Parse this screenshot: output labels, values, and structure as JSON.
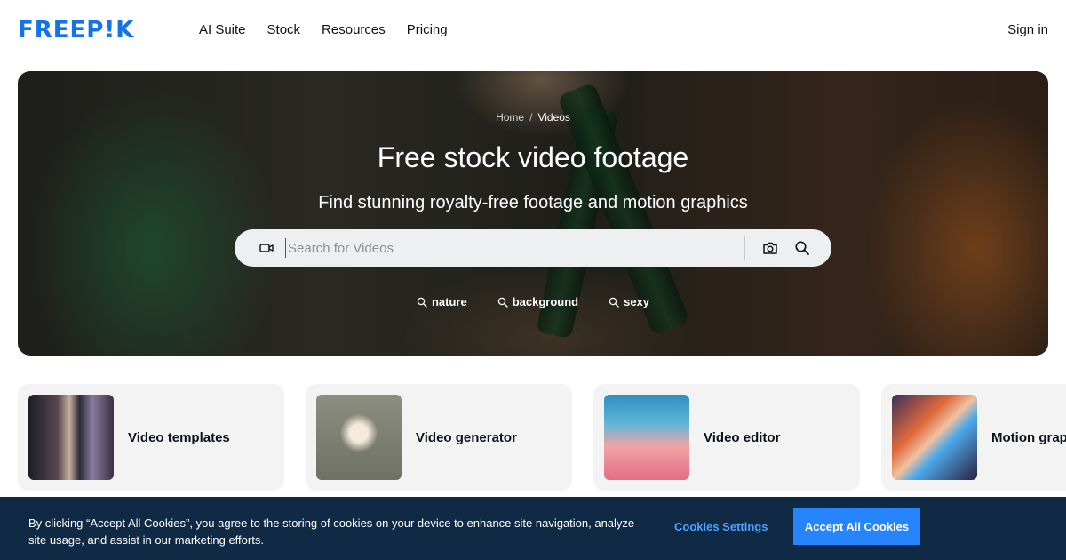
{
  "header": {
    "logo": "FREEP!K",
    "nav": [
      "AI Suite",
      "Stock",
      "Resources",
      "Pricing"
    ],
    "signin": "Sign in"
  },
  "hero": {
    "breadcrumb": {
      "home": "Home",
      "separator": "/",
      "current": "Videos"
    },
    "title": "Free stock video footage",
    "subtitle": "Find stunning royalty-free footage and motion graphics",
    "search": {
      "placeholder": "Search for Videos",
      "value": ""
    },
    "tags": [
      "nature",
      "background",
      "sexy"
    ]
  },
  "cards": [
    {
      "label": "Video templates"
    },
    {
      "label": "Video generator"
    },
    {
      "label": "Video editor"
    },
    {
      "label": "Motion graphics"
    }
  ],
  "cookie": {
    "text": "By clicking “Accept All Cookies”, you agree to the storing of cookies on your device to enhance site navigation, analyze site usage, and assist in our marketing efforts.",
    "settings": "Cookies Settings",
    "accept": "Accept All Cookies"
  },
  "colors": {
    "brand": "#1273eb",
    "cookie_bg": "#102945",
    "accept_button": "#2684ff",
    "settings_link": "#4aa3ff"
  },
  "icons": [
    "video-camera-icon",
    "camera-icon",
    "search-icon"
  ]
}
